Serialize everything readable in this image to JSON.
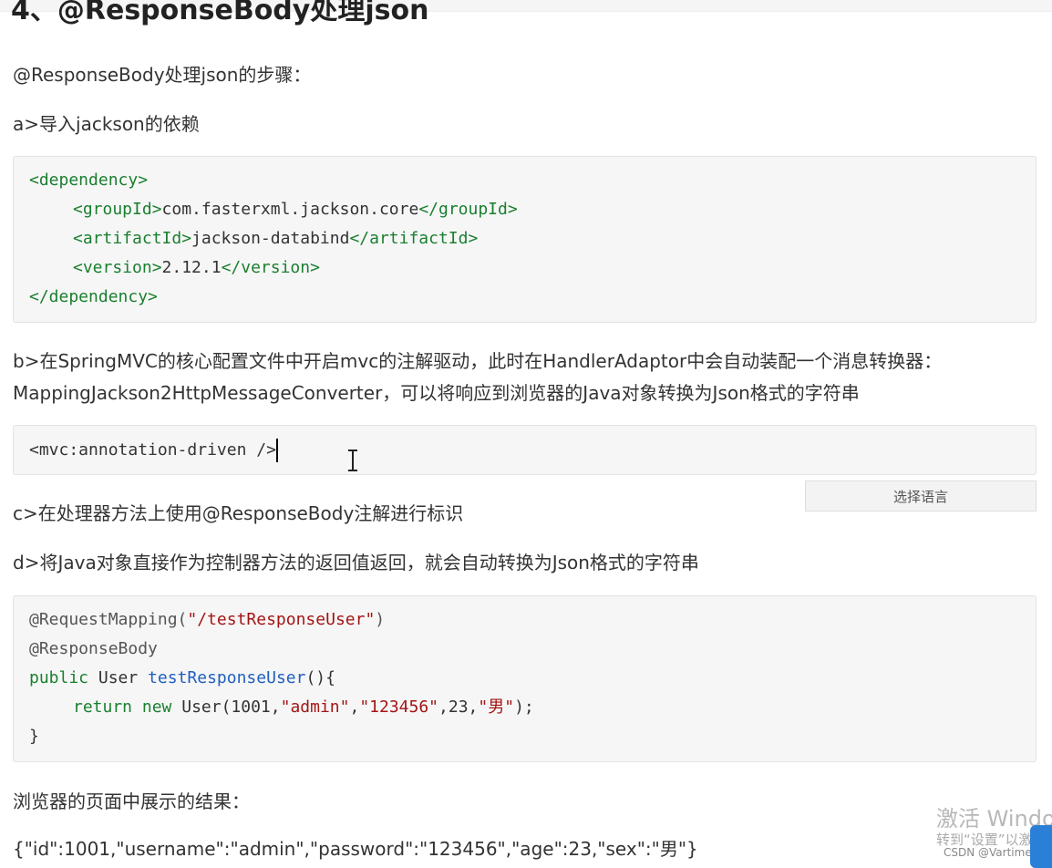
{
  "heading": "4、@ResponseBody处理json",
  "p1": "@ResponseBody处理json的步骤：",
  "p2": "a>导入jackson的依赖",
  "code1": {
    "l1": "<dependency>",
    "l2a": "<groupId>",
    "l2b": "com.fasterxml.jackson.core",
    "l2c": "</groupId>",
    "l3a": "<artifactId>",
    "l3b": "jackson-databind",
    "l3c": "</artifactId>",
    "l4a": "<version>",
    "l4b": "2.12.1",
    "l4c": "</version>",
    "l5": "</dependency>"
  },
  "p3": "b>在SpringMVC的核心配置文件中开启mvc的注解驱动，此时在HandlerAdaptor中会自动装配一个消息转换器：",
  "p4": "MappingJackson2HttpMessageConverter，可以将响应到浏览器的Java对象转换为Json格式的字符串",
  "code2": {
    "l1": "<mvc:annotation-driven />"
  },
  "lang_button": "选择语言",
  "p5": "c>在处理器方法上使用@ResponseBody注解进行标识",
  "p6": "d>将Java对象直接作为控制器方法的返回值返回，就会自动转换为Json格式的字符串",
  "code3": {
    "l1a": "@RequestMapping(",
    "l1b": "\"/testResponseUser\"",
    "l1c": ")",
    "l2": "@ResponseBody",
    "l3a": "public",
    "l3b": " User ",
    "l3c": "testResponseUser",
    "l3d": "(){",
    "l4a": "return",
    "l4b": " ",
    "l4c": "new",
    "l4d": " User(1001,",
    "l4e": "\"admin\"",
    "l4f": ",",
    "l4g": "\"123456\"",
    "l4h": ",23,",
    "l4i": "\"男\"",
    "l4j": ");",
    "l5": "}"
  },
  "p7": "浏览器的页面中展示的结果：",
  "p8": "{\"id\":1001,\"username\":\"admin\",\"password\":\"123456\",\"age\":23,\"sex\":\"男\"}",
  "watermark": {
    "line1": "激活 Windo",
    "line2": "转到“设置”以激"
  },
  "csdn": "CSDN @Vartimes"
}
